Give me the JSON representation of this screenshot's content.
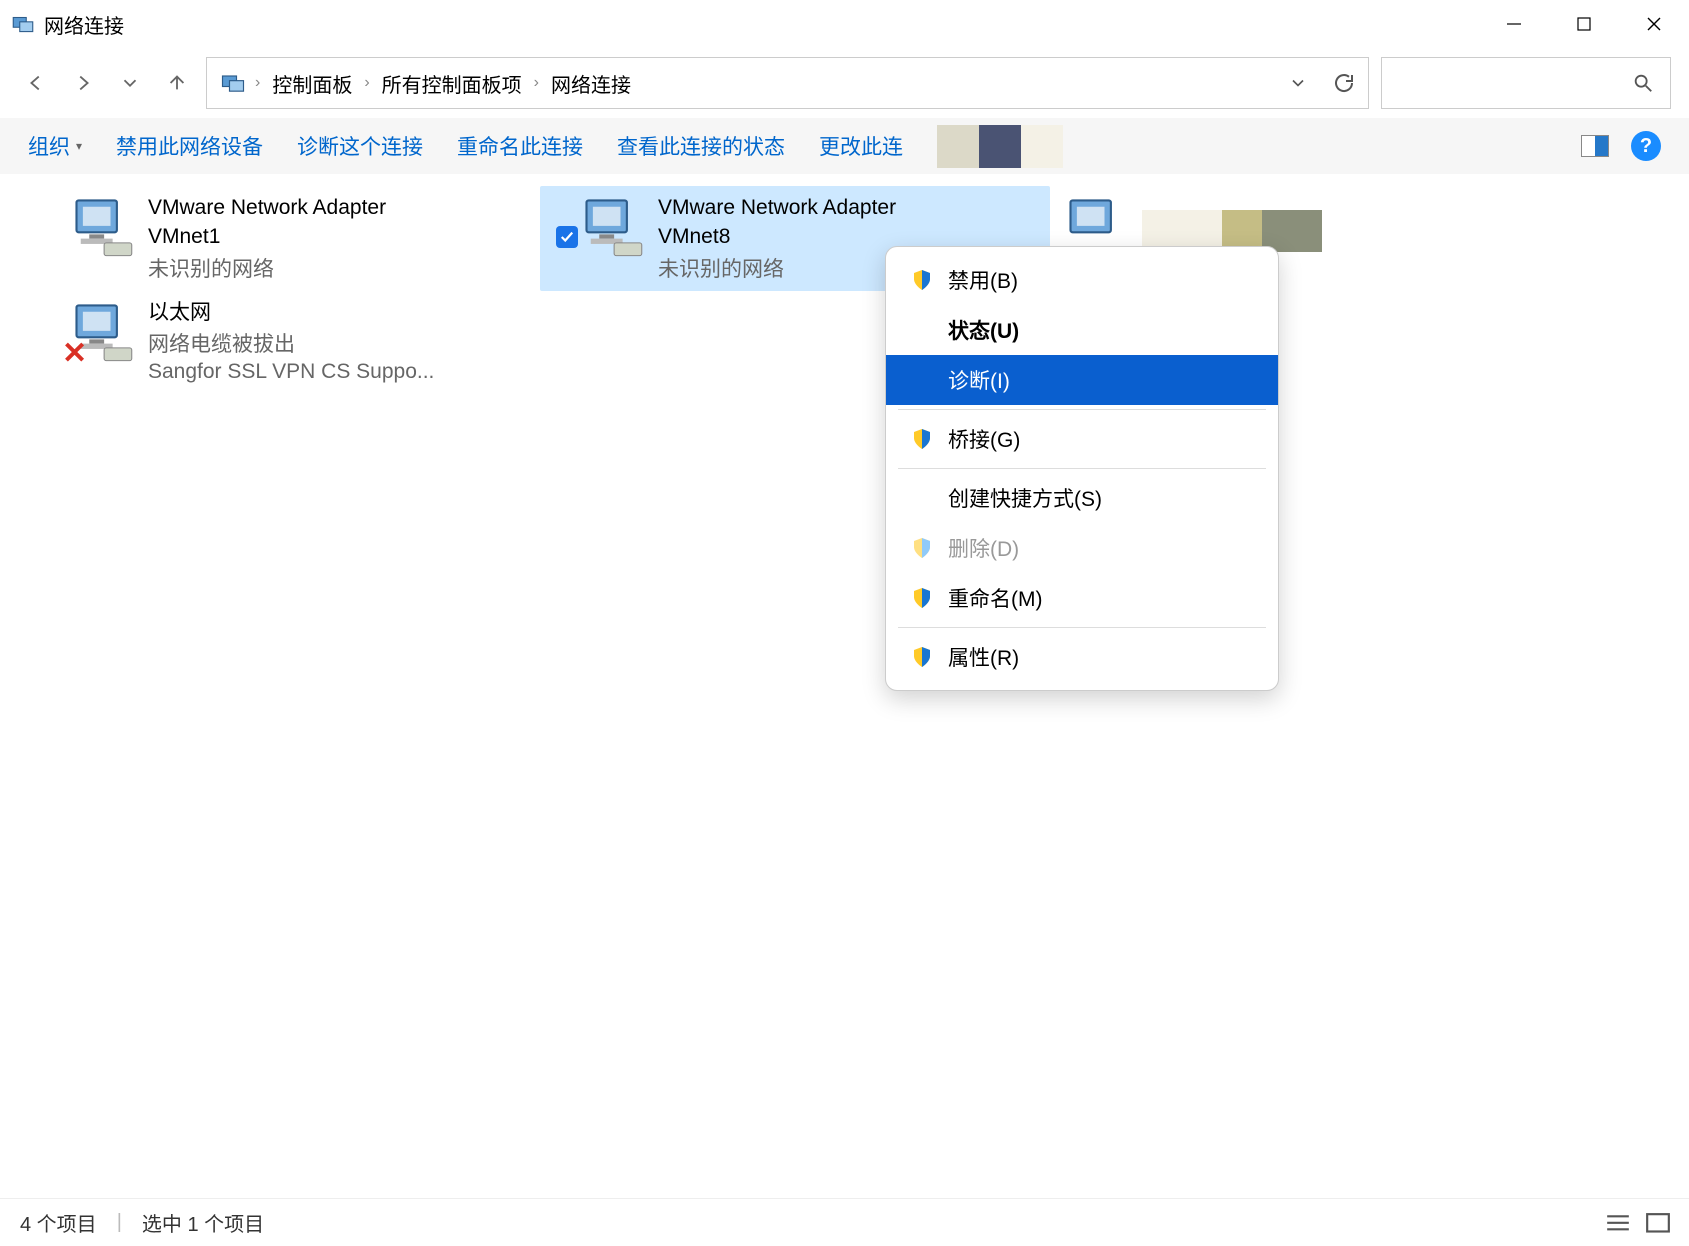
{
  "window": {
    "title": "网络连接"
  },
  "breadcrumb": {
    "items": [
      "控制面板",
      "所有控制面板项",
      "网络连接"
    ]
  },
  "toolbar": {
    "organize": "组织",
    "disable": "禁用此网络设备",
    "diagnose": "诊断这个连接",
    "rename": "重命名此连接",
    "view_status": "查看此连接的状态",
    "change": "更改此连"
  },
  "adapters": [
    {
      "title1": "VMware Network Adapter",
      "title2": "VMnet1",
      "sub": "未识别的网络"
    },
    {
      "title1": "VMware Network Adapter",
      "title2": "VMnet8",
      "sub": "未识别的网络",
      "selected": true
    },
    {
      "title1": "",
      "title2": "",
      "sub": ""
    },
    {
      "title1": "以太网",
      "sub1": "网络电缆被拔出",
      "sub2": "Sangfor SSL VPN CS Suppo..."
    }
  ],
  "context_menu": {
    "disable": "禁用(B)",
    "status": "状态(U)",
    "diagnose": "诊断(I)",
    "bridge": "桥接(G)",
    "shortcut": "创建快捷方式(S)",
    "delete": "删除(D)",
    "rename": "重命名(M)",
    "properties": "属性(R)"
  },
  "statusbar": {
    "items": "4 个项目",
    "selected": "选中 1 个项目"
  }
}
